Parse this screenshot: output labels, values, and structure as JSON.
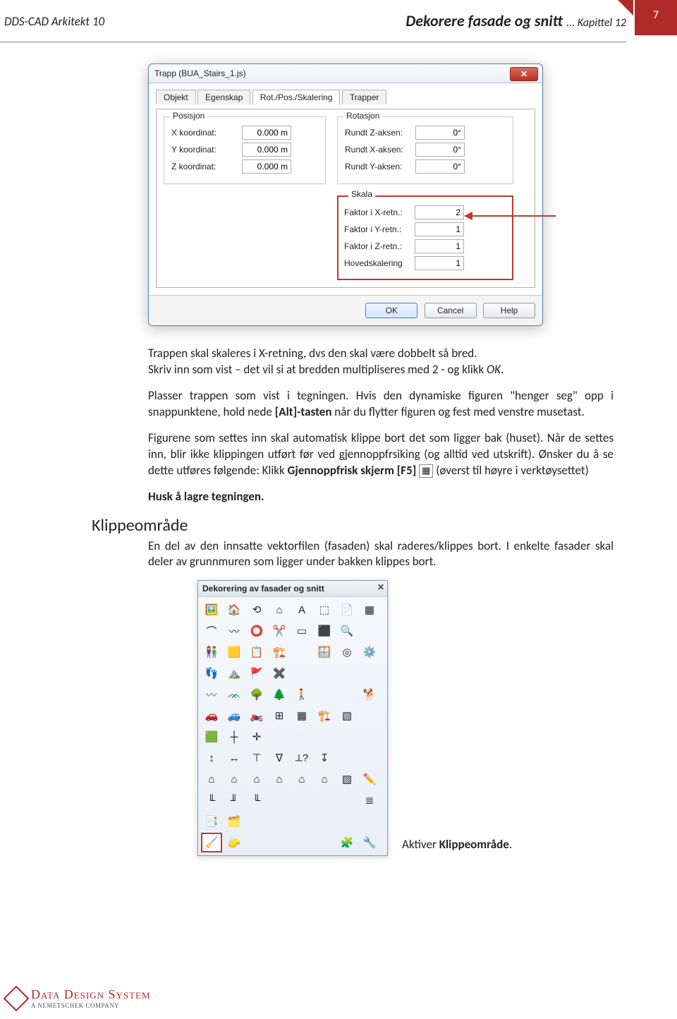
{
  "header": {
    "left": "DDS-CAD Arkitekt 10",
    "title_main": "Dekorere fasade og snitt",
    "title_sub": "... Kapittel 12",
    "page_number": "7"
  },
  "dialog": {
    "title": "Trapp (BUA_Stairs_1.js)",
    "tabs": {
      "t0": "Objekt",
      "t1": "Egenskap",
      "t2": "Rot./Pos./Skalering",
      "t3": "Trapper"
    },
    "pos_legend": "Posisjon",
    "rot_legend": "Rotasjon",
    "skala_legend": "Skala",
    "pos": {
      "x_lbl": "X koordinat:",
      "y_lbl": "Y koordinat:",
      "z_lbl": "Z koordinat:",
      "x_val": "0.000 m",
      "y_val": "0.000 m",
      "z_val": "0.000 m"
    },
    "rot": {
      "rz_lbl": "Rundt Z-aksen:",
      "rx_lbl": "Rundt X-aksen:",
      "ry_lbl": "Rundt Y-aksen:",
      "rz_val": "0°",
      "rx_val": "0°",
      "ry_val": "0°"
    },
    "skala": {
      "fx_lbl": "Faktor i X-retn.:",
      "fy_lbl": "Faktor i Y-retn.:",
      "fz_lbl": "Faktor i Z-retn.:",
      "h_lbl": "Hovedskalering",
      "fx_val": "2",
      "fy_val": "1",
      "fz_val": "1",
      "h_val": "1"
    },
    "buttons": {
      "ok": "OK",
      "cancel": "Cancel",
      "help": "Help"
    }
  },
  "text": {
    "p1a": "Trappen skal skaleres i X-retning, dvs den skal være dobbelt så bred.",
    "p1b": "Skriv inn som vist – det vil si at bredden multipliseres med 2 - og klikk ",
    "p1b_ok": "OK",
    "p1b_end": ".",
    "p2a": "Plasser trappen som vist i tegningen. Hvis den dynamiske figuren \"henger seg\" opp i snappunktene, hold nede ",
    "p2_key": "[Alt]-tasten",
    "p2b": " når du flytter figuren og fest med venstre musetast.",
    "p3": "Figurene som settes inn skal automatisk klippe bort det som ligger bak (huset). Når de settes inn, blir ikke klippingen utført før ved gjennoppfrsiking (og alltid ved utskrift). Ønsker du å se dette utføres følgende: Klikk ",
    "p3_cmd": "Gjennoppfrisk skjerm [F5]",
    "p3_icon": "▦",
    "p3b": " (øverst til høyre i verktøysettet)",
    "p4": "Husk å lagre tegningen.",
    "section": "Klippeområde",
    "p5": "En del av den innsatte vektorfilen (fasaden) skal raderes/klippes bort. I enkelte fasader skal deler av grunnmuren som ligger under bakken klippes bort."
  },
  "toolbar": {
    "title": "Dekorering av fasader og snitt",
    "caption_a": "Aktiver ",
    "caption_b": "Klippeområde",
    "caption_c": "."
  },
  "footer": {
    "brand": "Data Design System",
    "sub": "A NEMETSCHEK COMPANY"
  }
}
